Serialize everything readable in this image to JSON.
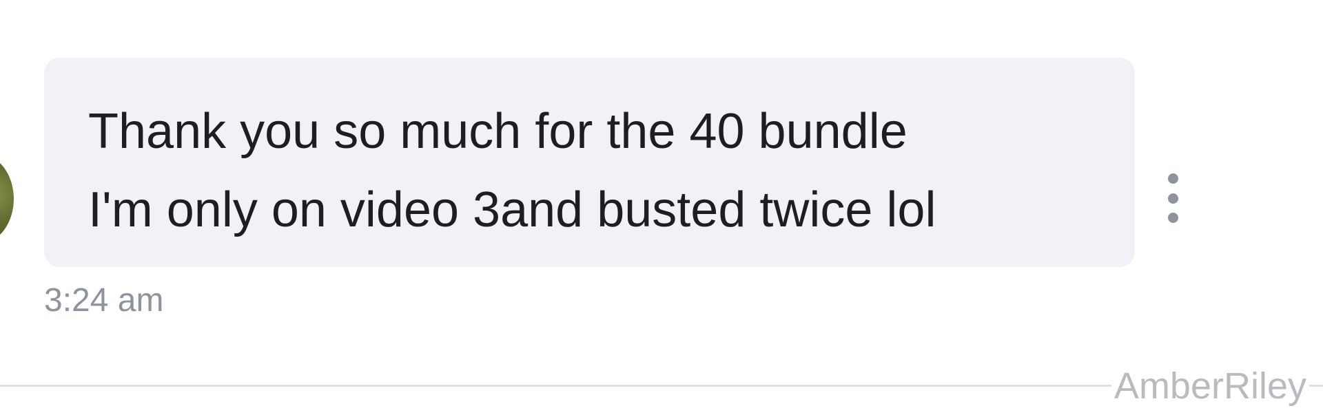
{
  "message": {
    "lines": [
      "Thank you so much for the 40 bundle",
      "I'm only on video 3and busted twice lol"
    ],
    "timestamp": "3:24 am"
  },
  "watermark": "AmberRiley",
  "icons": {
    "avatar": "avatar",
    "more": "more-vertical-icon"
  },
  "colors": {
    "bubble": "#f0f2f5",
    "text": "#1c1e21",
    "muted": "#8d949e",
    "divider": "#dddfe2"
  }
}
